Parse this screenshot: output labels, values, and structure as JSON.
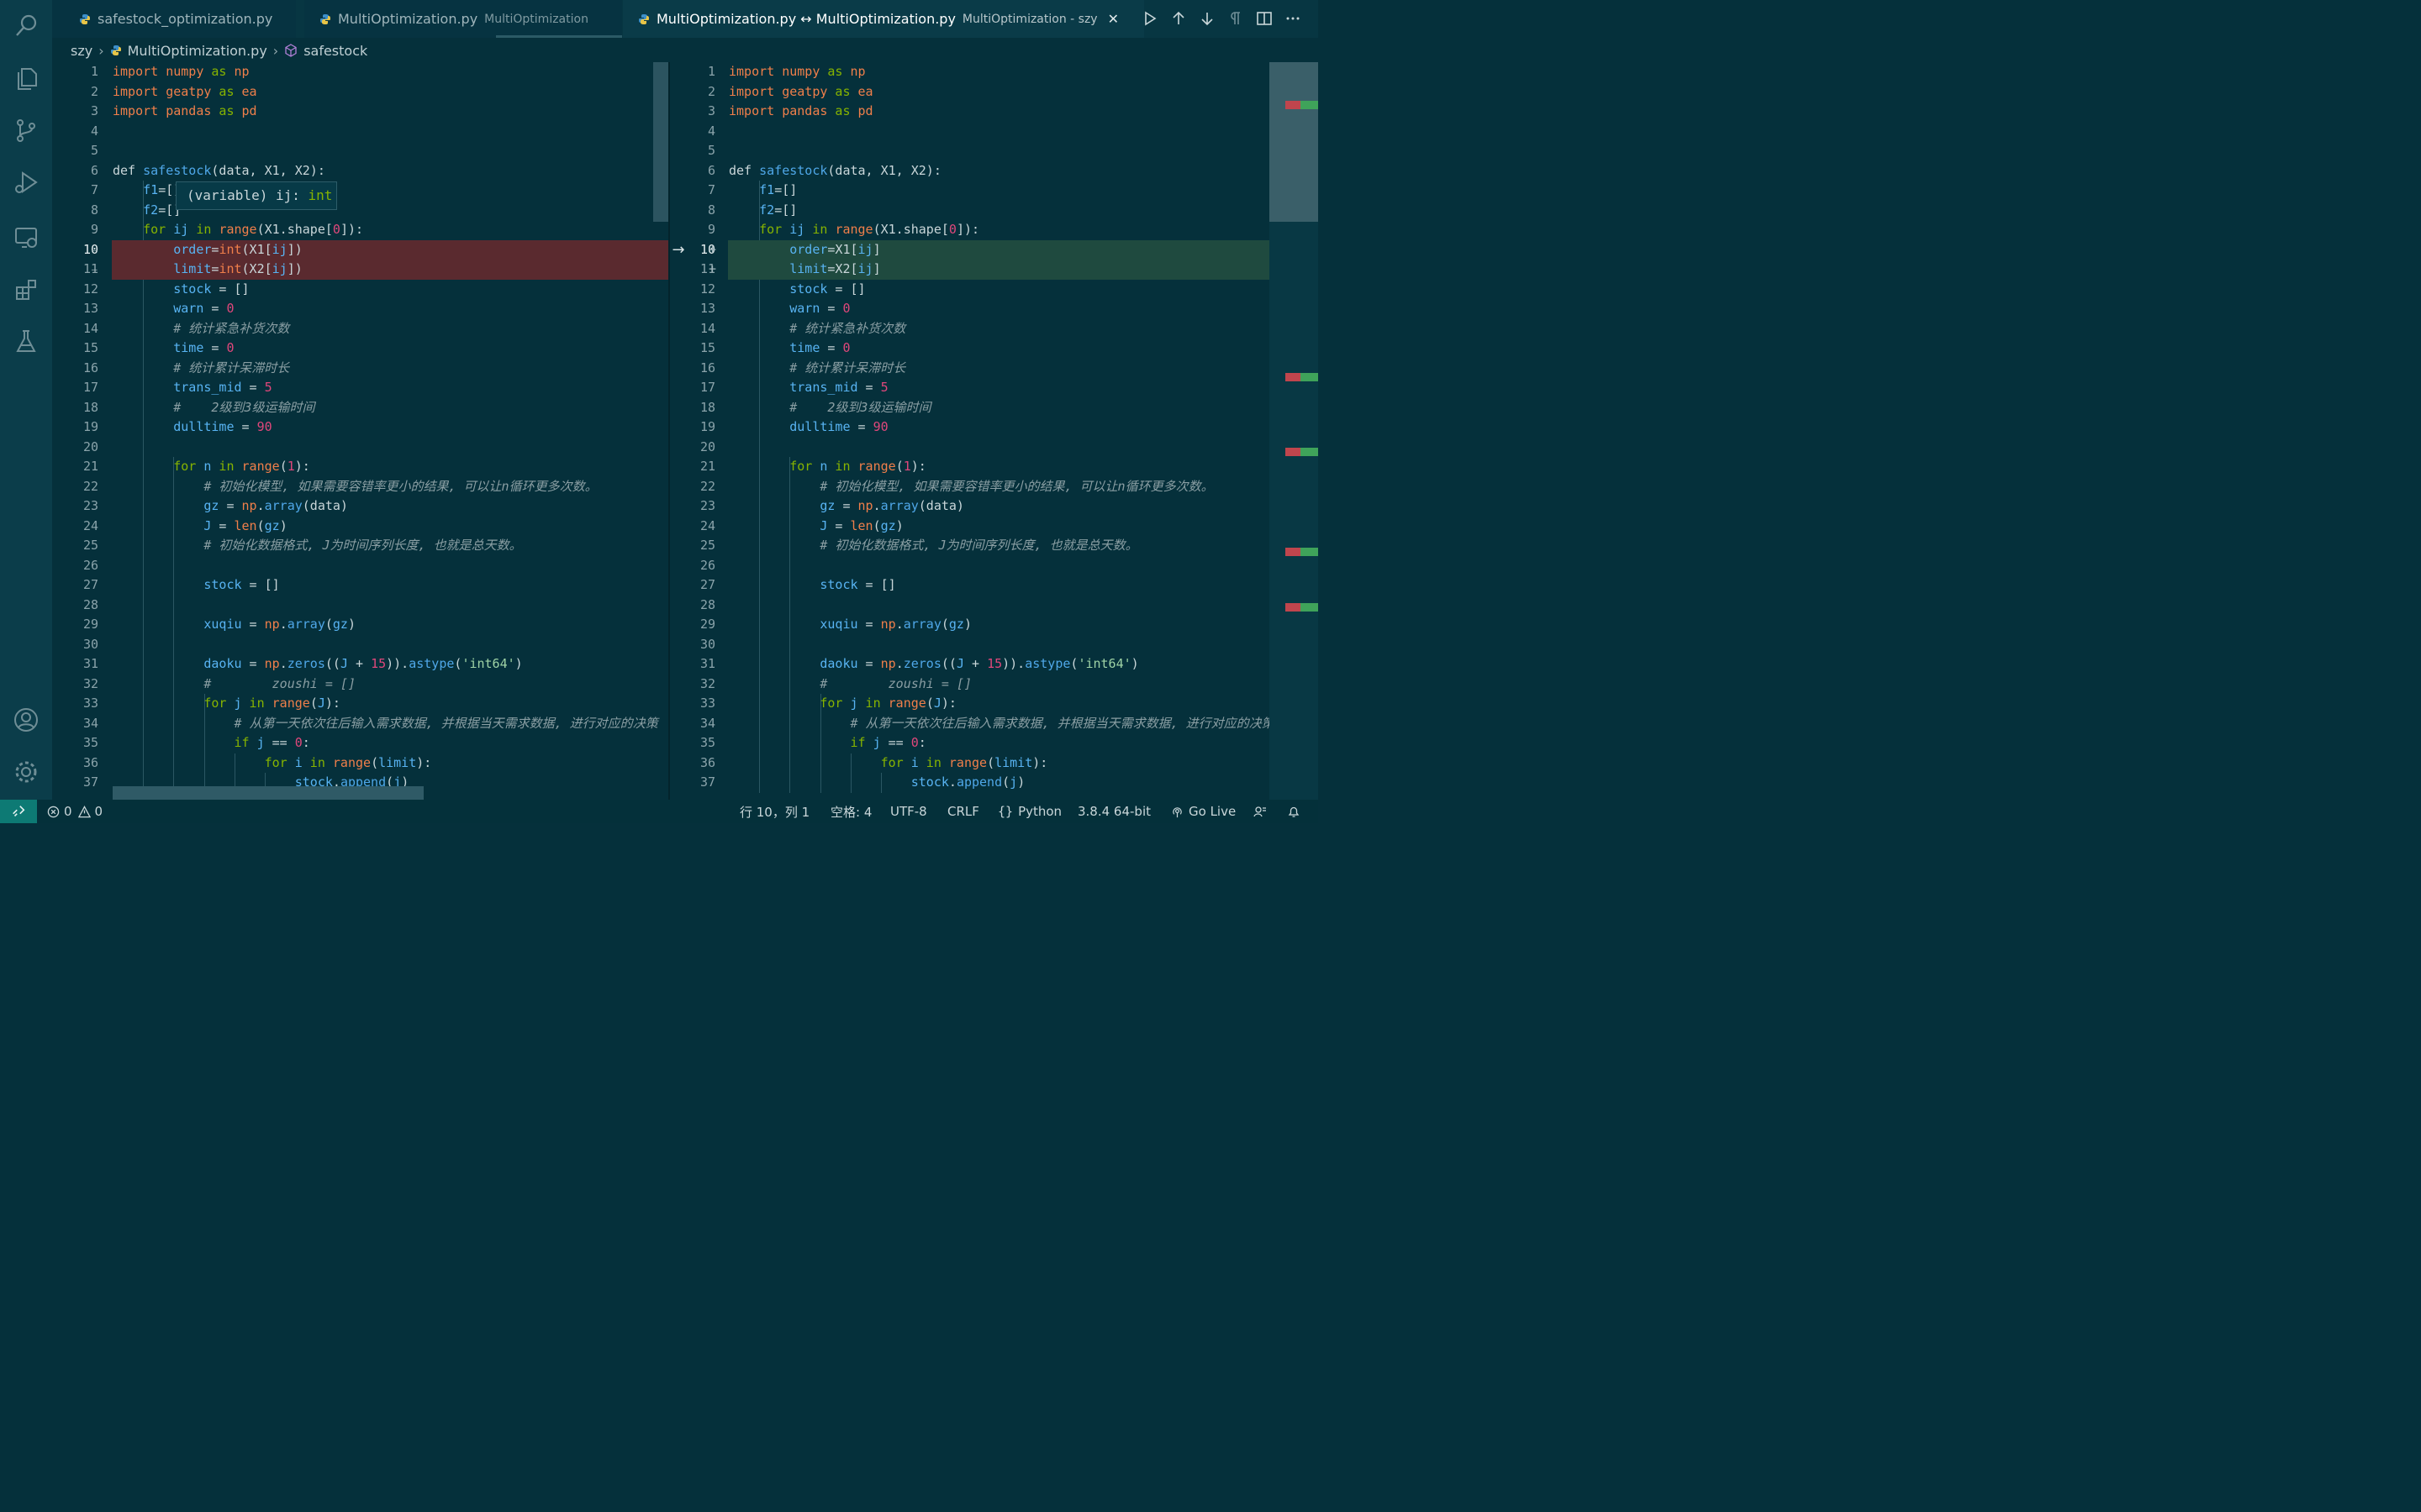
{
  "tabs": [
    {
      "label": "safestock_optimization.py",
      "description": ""
    },
    {
      "label": "MultiOptimization.py",
      "description": "MultiOptimization"
    },
    {
      "label": "MultiOptimization.py ↔ MultiOptimization.py",
      "description": "MultiOptimization - szy"
    }
  ],
  "breadcrumb": {
    "folder": "szy",
    "file": "MultiOptimization.py",
    "symbol": "safestock"
  },
  "hover": {
    "prefix": "(variable) ij: ",
    "type": "int"
  },
  "left_lines": [
    [
      [
        "mod",
        "import "
      ],
      [
        "mod",
        "numpy"
      ],
      [
        "kw",
        " as "
      ],
      [
        "mod",
        "np"
      ]
    ],
    [
      [
        "mod",
        "import "
      ],
      [
        "mod",
        "geatpy"
      ],
      [
        "kw",
        " as "
      ],
      [
        "mod",
        "ea"
      ]
    ],
    [
      [
        "mod",
        "import "
      ],
      [
        "mod",
        "pandas"
      ],
      [
        "kw",
        " as "
      ],
      [
        "mod",
        "pd"
      ]
    ],
    [],
    [],
    [
      [
        "pl",
        "def "
      ],
      [
        "fn",
        "safestock"
      ],
      [
        "pl",
        "(data, X1, X2):"
      ]
    ],
    [
      [
        "pl",
        "    "
      ],
      [
        "var",
        "f1"
      ],
      [
        "pl",
        "=[]"
      ]
    ],
    [
      [
        "pl",
        "    "
      ],
      [
        "var",
        "f2"
      ],
      [
        "pl",
        "=[]"
      ]
    ],
    [
      [
        "pl",
        "    "
      ],
      [
        "kw",
        "for "
      ],
      [
        "var",
        "ij"
      ],
      [
        "kw",
        " in "
      ],
      [
        "mod",
        "range"
      ],
      [
        "pl",
        "(X1.shape["
      ],
      [
        "num",
        "0"
      ],
      [
        "pl",
        "]):"
      ]
    ],
    [
      [
        "pl",
        "        "
      ],
      [
        "var",
        "order"
      ],
      [
        "pl",
        "="
      ],
      [
        "mod",
        "int"
      ],
      [
        "pl",
        "(X1["
      ],
      [
        "var",
        "ij"
      ],
      [
        "pl",
        "])"
      ]
    ],
    [
      [
        "pl",
        "        "
      ],
      [
        "var",
        "limit"
      ],
      [
        "pl",
        "="
      ],
      [
        "mod",
        "int"
      ],
      [
        "pl",
        "(X2["
      ],
      [
        "var",
        "ij"
      ],
      [
        "pl",
        "])"
      ]
    ],
    [
      [
        "pl",
        "        "
      ],
      [
        "var",
        "stock"
      ],
      [
        "pl",
        " = []"
      ]
    ],
    [
      [
        "pl",
        "        "
      ],
      [
        "var",
        "warn"
      ],
      [
        "pl",
        " = "
      ],
      [
        "num",
        "0"
      ]
    ],
    [
      [
        "pl",
        "        "
      ],
      [
        "cm",
        "# 统计紧急补货次数"
      ]
    ],
    [
      [
        "pl",
        "        "
      ],
      [
        "var",
        "time"
      ],
      [
        "pl",
        " = "
      ],
      [
        "num",
        "0"
      ]
    ],
    [
      [
        "pl",
        "        "
      ],
      [
        "cm",
        "# 统计累计呆滞时长"
      ]
    ],
    [
      [
        "pl",
        "        "
      ],
      [
        "var",
        "trans_mid"
      ],
      [
        "pl",
        " = "
      ],
      [
        "num",
        "5"
      ]
    ],
    [
      [
        "pl",
        "        "
      ],
      [
        "cm",
        "#    2级到3级运输时间"
      ]
    ],
    [
      [
        "pl",
        "        "
      ],
      [
        "var",
        "dulltime"
      ],
      [
        "pl",
        " = "
      ],
      [
        "num",
        "90"
      ]
    ],
    [],
    [
      [
        "pl",
        "        "
      ],
      [
        "kw",
        "for "
      ],
      [
        "var",
        "n"
      ],
      [
        "kw",
        " in "
      ],
      [
        "mod",
        "range"
      ],
      [
        "pl",
        "("
      ],
      [
        "num",
        "1"
      ],
      [
        "pl",
        "):"
      ]
    ],
    [
      [
        "pl",
        "            "
      ],
      [
        "cm",
        "# 初始化模型, 如果需要容错率更小的结果, 可以让n循环更多次数。"
      ]
    ],
    [
      [
        "pl",
        "            "
      ],
      [
        "var",
        "gz"
      ],
      [
        "pl",
        " = "
      ],
      [
        "mod",
        "np"
      ],
      [
        "pl",
        "."
      ],
      [
        "fn",
        "array"
      ],
      [
        "pl",
        "(data)"
      ]
    ],
    [
      [
        "pl",
        "            "
      ],
      [
        "var",
        "J"
      ],
      [
        "pl",
        " = "
      ],
      [
        "mod",
        "len"
      ],
      [
        "pl",
        "("
      ],
      [
        "var",
        "gz"
      ],
      [
        "pl",
        ")"
      ]
    ],
    [
      [
        "pl",
        "            "
      ],
      [
        "cm",
        "# 初始化数据格式, J为时间序列长度, 也就是总天数。"
      ]
    ],
    [],
    [
      [
        "pl",
        "            "
      ],
      [
        "var",
        "stock"
      ],
      [
        "pl",
        " = []"
      ]
    ],
    [],
    [
      [
        "pl",
        "            "
      ],
      [
        "var",
        "xuqiu"
      ],
      [
        "pl",
        " = "
      ],
      [
        "mod",
        "np"
      ],
      [
        "pl",
        "."
      ],
      [
        "fn",
        "array"
      ],
      [
        "pl",
        "("
      ],
      [
        "var",
        "gz"
      ],
      [
        "pl",
        ")"
      ]
    ],
    [],
    [
      [
        "pl",
        "            "
      ],
      [
        "var",
        "daoku"
      ],
      [
        "pl",
        " = "
      ],
      [
        "mod",
        "np"
      ],
      [
        "pl",
        "."
      ],
      [
        "fn",
        "zeros"
      ],
      [
        "pl",
        "(("
      ],
      [
        "var",
        "J"
      ],
      [
        "pl",
        " + "
      ],
      [
        "num",
        "15"
      ],
      [
        "pl",
        "))."
      ],
      [
        "fn",
        "astype"
      ],
      [
        "pl",
        "("
      ],
      [
        "str",
        "'int64'"
      ],
      [
        "pl",
        ")"
      ]
    ],
    [
      [
        "pl",
        "            "
      ],
      [
        "cm",
        "#        zoushi = []"
      ]
    ],
    [
      [
        "pl",
        "            "
      ],
      [
        "kw",
        "for "
      ],
      [
        "var",
        "j"
      ],
      [
        "kw",
        " in "
      ],
      [
        "mod",
        "range"
      ],
      [
        "pl",
        "("
      ],
      [
        "var",
        "J"
      ],
      [
        "pl",
        "):"
      ]
    ],
    [
      [
        "pl",
        "                "
      ],
      [
        "cm",
        "# 从第一天依次往后输入需求数据, 并根据当天需求数据, 进行对应的决策"
      ]
    ],
    [
      [
        "pl",
        "                "
      ],
      [
        "kw",
        "if "
      ],
      [
        "var",
        "j"
      ],
      [
        "pl",
        " == "
      ],
      [
        "num",
        "0"
      ],
      [
        "pl",
        ":"
      ]
    ],
    [
      [
        "pl",
        "                    "
      ],
      [
        "kw",
        "for "
      ],
      [
        "var",
        "i"
      ],
      [
        "kw",
        " in "
      ],
      [
        "mod",
        "range"
      ],
      [
        "pl",
        "("
      ],
      [
        "var",
        "limit"
      ],
      [
        "pl",
        "):"
      ]
    ],
    [
      [
        "pl",
        "                        "
      ],
      [
        "var",
        "stock"
      ],
      [
        "pl",
        "."
      ],
      [
        "fn",
        "append"
      ],
      [
        "pl",
        "("
      ],
      [
        "var",
        "j"
      ],
      [
        "pl",
        ")"
      ]
    ]
  ],
  "right_changed": [
    [
      [
        "pl",
        "        "
      ],
      [
        "var",
        "order"
      ],
      [
        "pl",
        "=X1["
      ],
      [
        "var",
        "ij"
      ],
      [
        "pl",
        "]"
      ]
    ],
    [
      [
        "pl",
        "        "
      ],
      [
        "var",
        "limit"
      ],
      [
        "pl",
        "=X2["
      ],
      [
        "var",
        "ij"
      ],
      [
        "pl",
        "]"
      ]
    ]
  ],
  "status": {
    "errors": "0",
    "warnings": "0",
    "position": "行 10，列 1",
    "indent": "空格: 4",
    "encoding": "UTF-8",
    "eol": "CRLF",
    "language": "Python",
    "interpreter": "3.8.4 64-bit",
    "live": "Go Live"
  },
  "colors": {
    "deleted": "#5a2a2f",
    "inserted": "#1f4a3f",
    "accent": "#0d7a74"
  },
  "icons": [
    "search-icon",
    "files-icon",
    "source-control-icon",
    "run-debug-icon",
    "remote-explorer-icon",
    "extensions-icon",
    "testing-icon",
    "account-icon",
    "settings-gear-icon",
    "python-file-icon",
    "symbol-method-icon",
    "run-icon",
    "arrow-up-icon",
    "arrow-down-icon",
    "pilcrow-icon",
    "split-editor-icon",
    "more-icon",
    "close-icon",
    "error-icon",
    "warning-icon",
    "broadcast-icon",
    "feedback-icon",
    "bell-icon"
  ]
}
